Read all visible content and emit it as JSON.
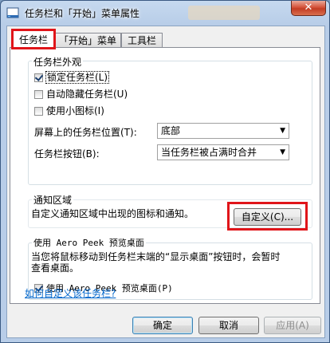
{
  "window": {
    "title": "任务栏和「开始」菜单属性",
    "close_label": "✕"
  },
  "tabs": [
    {
      "label": "任务栏",
      "active": true
    },
    {
      "label": "「开始」菜单",
      "active": false
    },
    {
      "label": "工具栏",
      "active": false
    }
  ],
  "appearance": {
    "legend": "任务栏外观",
    "lock_taskbar": {
      "label": "锁定任务栏(L)",
      "checked": true
    },
    "auto_hide": {
      "label": "自动隐藏任务栏(U)",
      "checked": false
    },
    "small_icons": {
      "label": "使用小图标(I)",
      "checked": false
    },
    "location_label": "屏幕上的任务栏位置(T):",
    "location_value": "底部",
    "buttons_label": "任务栏按钮(B):",
    "buttons_value": "当任务栏被占满时合并"
  },
  "notification": {
    "legend": "通知区域",
    "description": "自定义通知区域中出现的图标和通知。",
    "customize_button": "自定义(C)..."
  },
  "aero_peek": {
    "legend": "使用 Aero Peek 预览桌面",
    "description_line1": "当您将鼠标移动到任务栏末端的“显示桌面”按钮时，会暂时",
    "description_line2": "查看桌面。",
    "checkbox": {
      "label": "使用 Aero Peek 预览桌面(P)",
      "checked": true
    }
  },
  "help_link": "如何自定义该任务栏?",
  "footer": {
    "ok": "确定",
    "cancel": "取消",
    "apply": "应用(A)"
  }
}
